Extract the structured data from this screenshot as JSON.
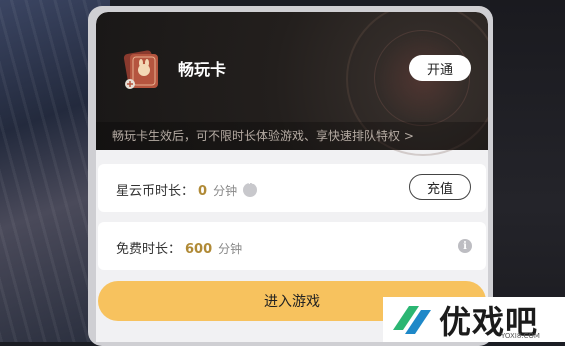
{
  "vip_card": {
    "title": "畅玩卡",
    "open_label": "开通",
    "description": "畅玩卡生效后，可不限时长体验游戏、享快速排队特权 >"
  },
  "coin_time": {
    "label": "星云币时长：",
    "value": "0",
    "unit": "分钟",
    "recharge_label": "充值"
  },
  "free_time": {
    "label": "免费时长：",
    "value": "600",
    "unit": "分钟",
    "info_glyph": "i"
  },
  "enter_game_label": "进入游戏",
  "watermark": {
    "brand": "优戏吧",
    "url": "YOXI8.COM"
  },
  "colors": {
    "accent": "#f7c25e",
    "value_gold": "#b08a36",
    "card_dark": "#231f1d"
  }
}
